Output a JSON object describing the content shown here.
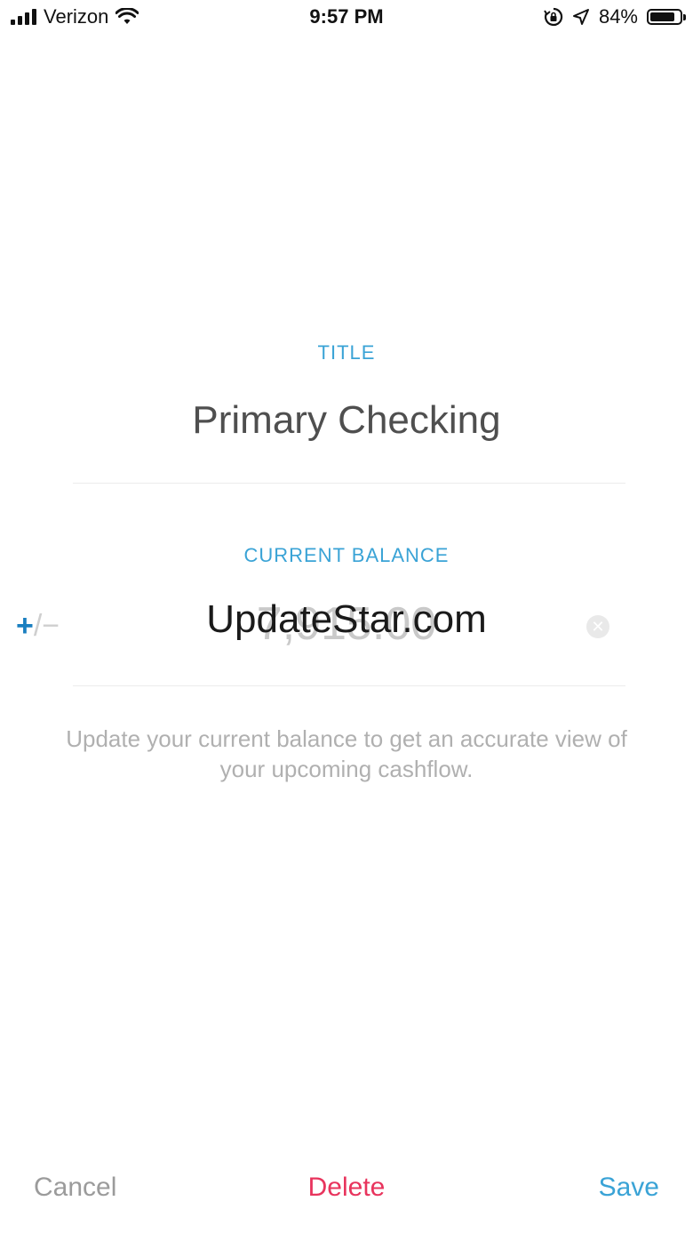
{
  "status_bar": {
    "carrier": "Verizon",
    "time": "9:57 PM",
    "battery_percent": "84%",
    "battery_level": 0.84,
    "icons": [
      "signal-icon",
      "wifi-icon",
      "rotation-lock-icon",
      "location-icon",
      "battery-icon"
    ]
  },
  "form": {
    "title_label": "TITLE",
    "title_value": "Primary Checking",
    "balance_label": "CURRENT BALANCE",
    "balance_value": "7,915.00",
    "sign_plus": "+",
    "sign_minus": "/−",
    "watermark": "UpdateStar.com",
    "help_text": "Update your current balance to get an accurate view of your upcoming cashflow."
  },
  "actions": {
    "cancel": "Cancel",
    "delete": "Delete",
    "save": "Save"
  },
  "colors": {
    "accent_blue": "#3aa3d6",
    "delete_red": "#e8345d",
    "muted_gray": "#9b9b9b"
  }
}
